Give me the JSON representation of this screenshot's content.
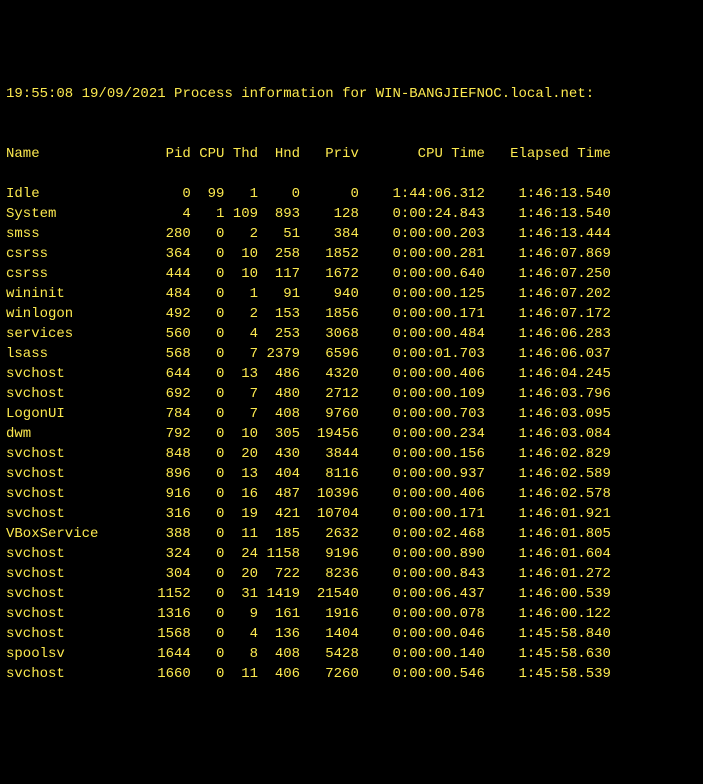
{
  "header": {
    "timestamp": "19:55:08 19/09/2021",
    "text": "Process information for",
    "hostname": "WIN-BANGJIEFNOC.local.net:"
  },
  "columns": {
    "name": "Name",
    "pid": "Pid",
    "cpu": "CPU",
    "thd": "Thd",
    "hnd": "Hnd",
    "priv": "Priv",
    "cputime": "CPU Time",
    "elapsed": "Elapsed Time"
  },
  "processes": [
    {
      "name": "Idle",
      "pid": 0,
      "cpu": 99,
      "thd": 1,
      "hnd": 0,
      "priv": 0,
      "cputime": "1:44:06.312",
      "elapsed": "1:46:13.540"
    },
    {
      "name": "System",
      "pid": 4,
      "cpu": 1,
      "thd": 109,
      "hnd": 893,
      "priv": 128,
      "cputime": "0:00:24.843",
      "elapsed": "1:46:13.540"
    },
    {
      "name": "smss",
      "pid": 280,
      "cpu": 0,
      "thd": 2,
      "hnd": 51,
      "priv": 384,
      "cputime": "0:00:00.203",
      "elapsed": "1:46:13.444"
    },
    {
      "name": "csrss",
      "pid": 364,
      "cpu": 0,
      "thd": 10,
      "hnd": 258,
      "priv": 1852,
      "cputime": "0:00:00.281",
      "elapsed": "1:46:07.869"
    },
    {
      "name": "csrss",
      "pid": 444,
      "cpu": 0,
      "thd": 10,
      "hnd": 117,
      "priv": 1672,
      "cputime": "0:00:00.640",
      "elapsed": "1:46:07.250"
    },
    {
      "name": "wininit",
      "pid": 484,
      "cpu": 0,
      "thd": 1,
      "hnd": 91,
      "priv": 940,
      "cputime": "0:00:00.125",
      "elapsed": "1:46:07.202"
    },
    {
      "name": "winlogon",
      "pid": 492,
      "cpu": 0,
      "thd": 2,
      "hnd": 153,
      "priv": 1856,
      "cputime": "0:00:00.171",
      "elapsed": "1:46:07.172"
    },
    {
      "name": "services",
      "pid": 560,
      "cpu": 0,
      "thd": 4,
      "hnd": 253,
      "priv": 3068,
      "cputime": "0:00:00.484",
      "elapsed": "1:46:06.283"
    },
    {
      "name": "lsass",
      "pid": 568,
      "cpu": 0,
      "thd": 7,
      "hnd": 2379,
      "priv": 6596,
      "cputime": "0:00:01.703",
      "elapsed": "1:46:06.037"
    },
    {
      "name": "svchost",
      "pid": 644,
      "cpu": 0,
      "thd": 13,
      "hnd": 486,
      "priv": 4320,
      "cputime": "0:00:00.406",
      "elapsed": "1:46:04.245"
    },
    {
      "name": "svchost",
      "pid": 692,
      "cpu": 0,
      "thd": 7,
      "hnd": 480,
      "priv": 2712,
      "cputime": "0:00:00.109",
      "elapsed": "1:46:03.796"
    },
    {
      "name": "LogonUI",
      "pid": 784,
      "cpu": 0,
      "thd": 7,
      "hnd": 408,
      "priv": 9760,
      "cputime": "0:00:00.703",
      "elapsed": "1:46:03.095"
    },
    {
      "name": "dwm",
      "pid": 792,
      "cpu": 0,
      "thd": 10,
      "hnd": 305,
      "priv": 19456,
      "cputime": "0:00:00.234",
      "elapsed": "1:46:03.084"
    },
    {
      "name": "svchost",
      "pid": 848,
      "cpu": 0,
      "thd": 20,
      "hnd": 430,
      "priv": 3844,
      "cputime": "0:00:00.156",
      "elapsed": "1:46:02.829"
    },
    {
      "name": "svchost",
      "pid": 896,
      "cpu": 0,
      "thd": 13,
      "hnd": 404,
      "priv": 8116,
      "cputime": "0:00:00.937",
      "elapsed": "1:46:02.589"
    },
    {
      "name": "svchost",
      "pid": 916,
      "cpu": 0,
      "thd": 16,
      "hnd": 487,
      "priv": 10396,
      "cputime": "0:00:00.406",
      "elapsed": "1:46:02.578"
    },
    {
      "name": "svchost",
      "pid": 316,
      "cpu": 0,
      "thd": 19,
      "hnd": 421,
      "priv": 10704,
      "cputime": "0:00:00.171",
      "elapsed": "1:46:01.921"
    },
    {
      "name": "VBoxService",
      "pid": 388,
      "cpu": 0,
      "thd": 11,
      "hnd": 185,
      "priv": 2632,
      "cputime": "0:00:02.468",
      "elapsed": "1:46:01.805"
    },
    {
      "name": "svchost",
      "pid": 324,
      "cpu": 0,
      "thd": 24,
      "hnd": 1158,
      "priv": 9196,
      "cputime": "0:00:00.890",
      "elapsed": "1:46:01.604"
    },
    {
      "name": "svchost",
      "pid": 304,
      "cpu": 0,
      "thd": 20,
      "hnd": 722,
      "priv": 8236,
      "cputime": "0:00:00.843",
      "elapsed": "1:46:01.272"
    },
    {
      "name": "svchost",
      "pid": 1152,
      "cpu": 0,
      "thd": 31,
      "hnd": 1419,
      "priv": 21540,
      "cputime": "0:00:06.437",
      "elapsed": "1:46:00.539"
    },
    {
      "name": "svchost",
      "pid": 1316,
      "cpu": 0,
      "thd": 9,
      "hnd": 161,
      "priv": 1916,
      "cputime": "0:00:00.078",
      "elapsed": "1:46:00.122"
    },
    {
      "name": "svchost",
      "pid": 1568,
      "cpu": 0,
      "thd": 4,
      "hnd": 136,
      "priv": 1404,
      "cputime": "0:00:00.046",
      "elapsed": "1:45:58.840"
    },
    {
      "name": "spoolsv",
      "pid": 1644,
      "cpu": 0,
      "thd": 8,
      "hnd": 408,
      "priv": 5428,
      "cputime": "0:00:00.140",
      "elapsed": "1:45:58.630"
    },
    {
      "name": "svchost",
      "pid": 1660,
      "cpu": 0,
      "thd": 11,
      "hnd": 406,
      "priv": 7260,
      "cputime": "0:00:00.546",
      "elapsed": "1:45:58.539"
    }
  ]
}
